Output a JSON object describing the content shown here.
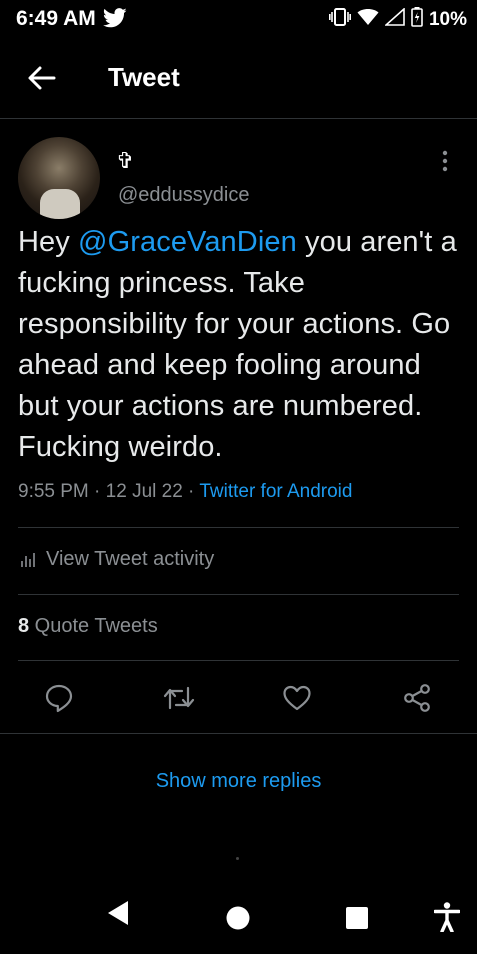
{
  "status_bar": {
    "time": "6:49 AM",
    "battery": "10%",
    "icons": [
      "twitter-bird-icon",
      "vibrate-icon",
      "wifi-icon",
      "signal-icon",
      "battery-icon"
    ]
  },
  "header": {
    "back_icon": "arrow-left-icon",
    "title": "Tweet"
  },
  "tweet": {
    "display_name": "✞",
    "handle": "@eddussydice",
    "text_before": "Hey ",
    "mention": "@GraceVanDien",
    "text_after": " you aren't a fucking princess. Take responsibility for your actions. Go ahead and keep fooling around but your actions are numbered. Fucking weirdo.",
    "time": "9:55 PM",
    "sep1": " · ",
    "date": "12 Jul 22",
    "sep2": " · ",
    "source": "Twitter for Android"
  },
  "activity": {
    "icon": "bar-chart-icon",
    "label": "View Tweet activity"
  },
  "quotes": {
    "count": "8",
    "label": " Quote Tweets"
  },
  "actions": [
    "reply-icon",
    "retweet-icon",
    "like-icon",
    "share-icon"
  ],
  "show_more_replies": "Show more replies",
  "nav_bar": [
    "back-triangle-icon",
    "home-circle-icon",
    "recents-square-icon",
    "accessibility-icon"
  ],
  "colors": {
    "background": "#000000",
    "text": "#e7e9ea",
    "secondary": "#8b8f93",
    "accent": "#1d9bf0",
    "divider": "#2f3336"
  }
}
